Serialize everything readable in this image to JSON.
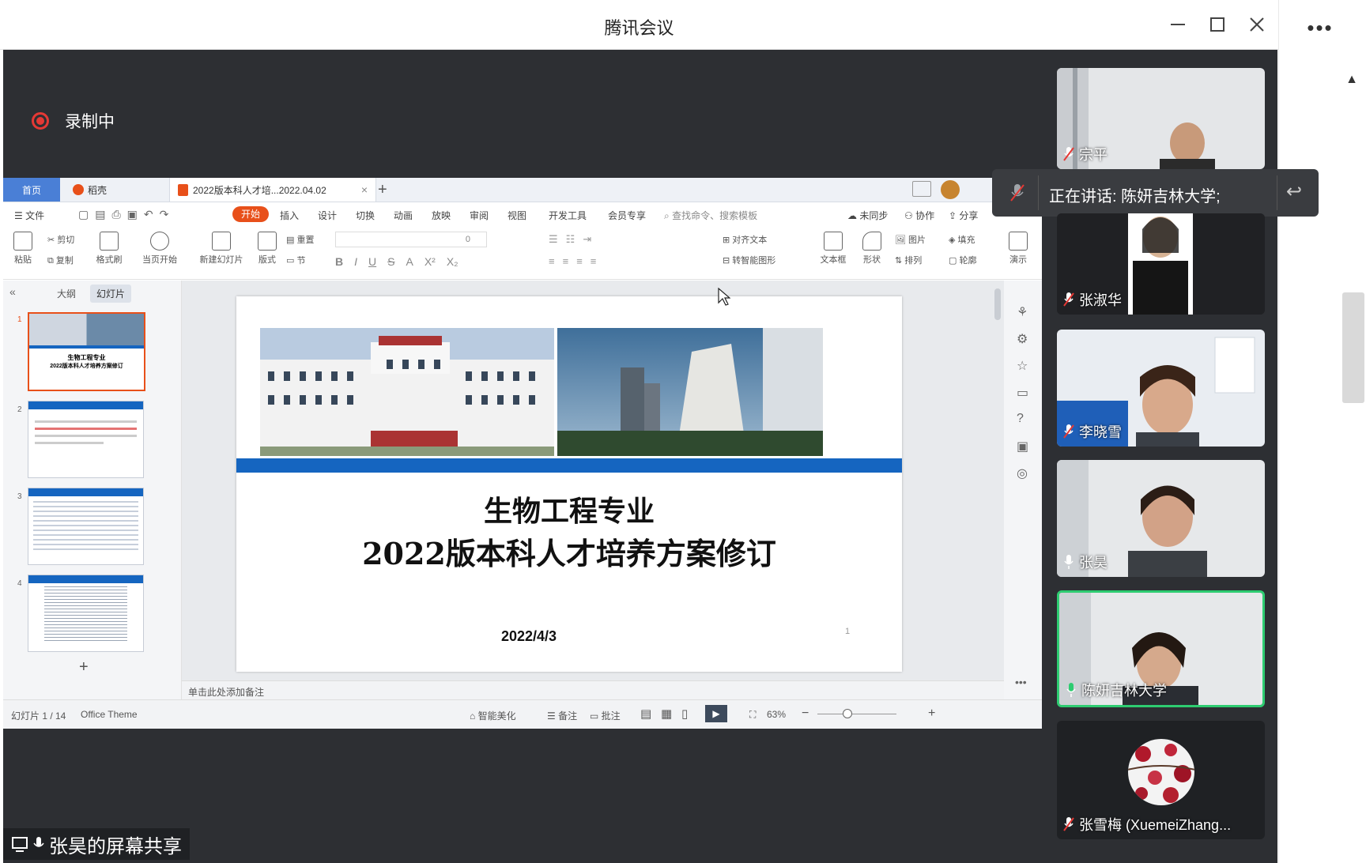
{
  "window": {
    "title": "腾讯会议",
    "more_icon": "more-dots-icon"
  },
  "recording": {
    "label": "录制中"
  },
  "speaking": {
    "label": "正在讲话: 陈妍吉林大学;"
  },
  "screen_share_label": "张昊的屏幕共享",
  "wps": {
    "tabs": [
      "首页",
      "稻壳",
      "2022版本科人才培...2022.04.02"
    ],
    "menu": [
      "文件",
      "开始",
      "插入",
      "设计",
      "切换",
      "动画",
      "放映",
      "审阅",
      "视图",
      "开发工具",
      "会员专享"
    ],
    "search_placeholder": "查找命令、搜索模板",
    "menu_right": [
      "未同步",
      "协作",
      "分享"
    ],
    "ribbon": {
      "paste": "粘贴",
      "cut": "剪切",
      "copy": "复制",
      "format_painter": "格式刷",
      "start_current": "当页开始",
      "new_slide": "新建幻灯片",
      "layout": "版式",
      "section": "节",
      "reset": "重置",
      "font_size": "0",
      "align_text": "对齐文本",
      "convert_smartart": "转智能图形",
      "textbox": "文本框",
      "shape": "形状",
      "arrange": "排列",
      "picture": "图片",
      "fill": "填充",
      "outline": "轮廓",
      "present": "演示"
    },
    "pane_tabs": [
      "大纲",
      "幻灯片"
    ],
    "thumb_numbers": [
      "1",
      "2",
      "3",
      "4"
    ],
    "thumb1_title": "生物工程专业",
    "thumb1_sub": "2022版本科人才培养方案修订",
    "slide": {
      "title": "生物工程专业",
      "subtitle": "2022版本科人才培养方案修订",
      "date": "2022/4/3",
      "page_number": "1"
    },
    "notes_placeholder": "单击此处添加备注",
    "status": {
      "slide_counter": "幻灯片 1 / 14",
      "theme": "Office Theme",
      "beautify": "智能美化",
      "notes": "备注",
      "comments": "批注",
      "zoom": "63%"
    }
  },
  "participants": [
    {
      "name": "宗平",
      "muted": true
    },
    {
      "name": "张淑华",
      "muted": true
    },
    {
      "name": "李晓雪",
      "muted": true
    },
    {
      "name": "张昊",
      "muted": false
    },
    {
      "name": "陈妍吉林大学",
      "muted": false,
      "active_speaker": true
    },
    {
      "name": "张雪梅 (XuemeiZhang...",
      "muted": true
    }
  ],
  "colors": {
    "meeting_bg": "#2d2f33",
    "record_red": "#e53935",
    "wps_orange": "#e8501a",
    "slide_blue": "#1565c0",
    "active_green": "#2ecc71"
  }
}
